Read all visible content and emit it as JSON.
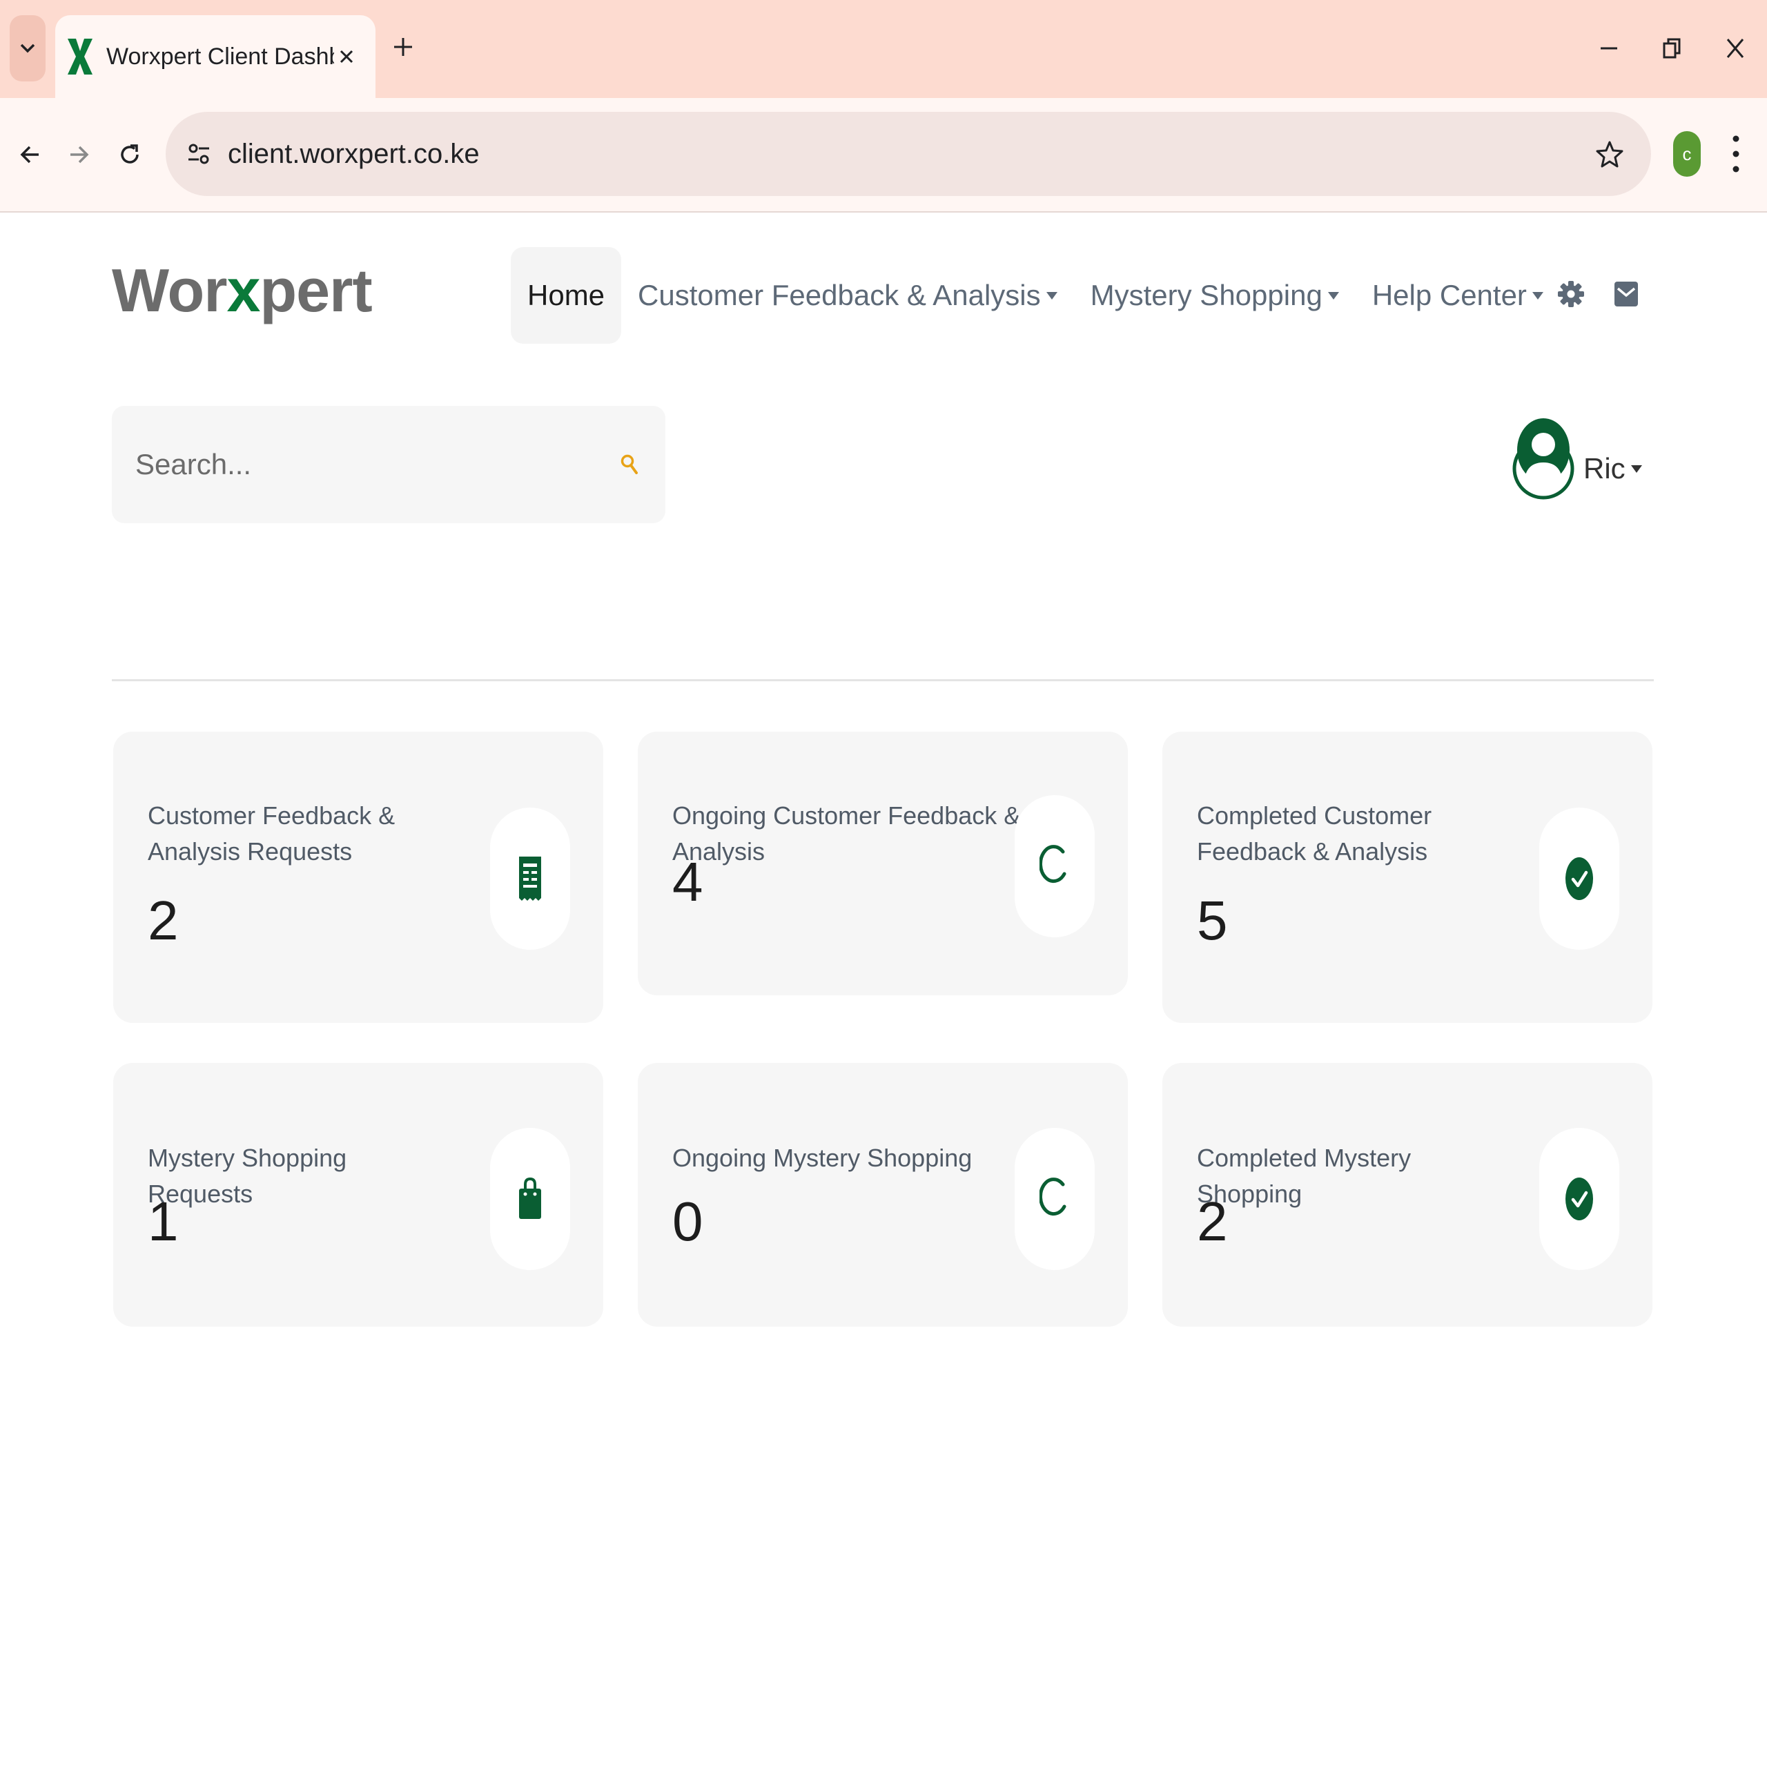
{
  "browser": {
    "tab_title": "Worxpert Client Dashboard",
    "url": "client.worxpert.co.ke",
    "profile_initial": "c"
  },
  "header": {
    "brand": {
      "part1": "Wor",
      "part2": "x",
      "part3": "pert"
    },
    "nav": [
      {
        "label": "Home",
        "active": true
      },
      {
        "label": "Customer Feedback & Analysis",
        "dropdown": true
      },
      {
        "label": "Mystery Shopping",
        "dropdown": true
      },
      {
        "label": "Help Center",
        "dropdown": true
      }
    ],
    "icons": [
      "gear-icon",
      "mail-icon"
    ]
  },
  "search": {
    "placeholder": "Search..."
  },
  "user": {
    "name": "Ric"
  },
  "cards": [
    {
      "label": "Customer Feedback & Analysis Requests",
      "value": "2",
      "icon": "receipt-icon"
    },
    {
      "label": "Ongoing Customer Feedback & Analysis",
      "value": "4",
      "icon": "spinner-icon"
    },
    {
      "label": "Completed Customer Feedback & Analysis",
      "value": "5",
      "icon": "check-circle-icon"
    },
    {
      "label": "Mystery Shopping Requests",
      "value": "1",
      "icon": "shopping-bag-icon"
    },
    {
      "label": "Ongoing Mystery Shopping",
      "value": "0",
      "icon": "spinner-icon"
    },
    {
      "label": "Completed Mystery Shopping",
      "value": "2",
      "icon": "check-circle-icon"
    }
  ],
  "colors": {
    "brand_green": "#0a5e33",
    "tabbar": "#fddbd0",
    "search_icon": "#e8a317"
  }
}
